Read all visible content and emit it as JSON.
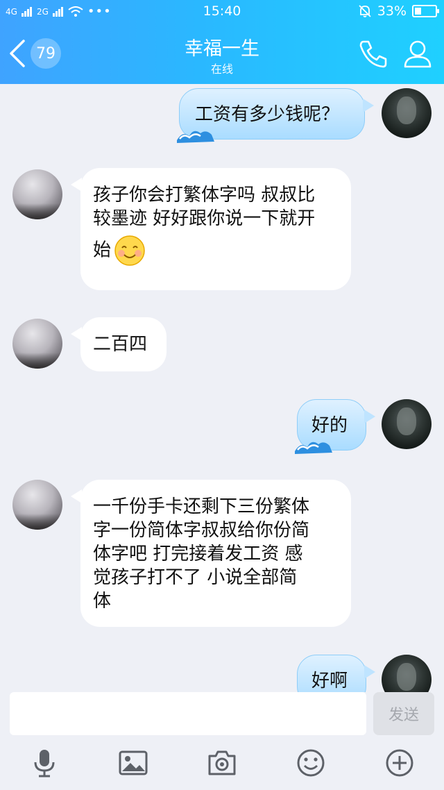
{
  "status_bar": {
    "net1": "4G",
    "net2": "2G",
    "time": "15:40",
    "battery": "33%",
    "battery_level": 0.33
  },
  "header": {
    "back_count": "79",
    "contact_name": "幸福一生",
    "contact_status": "在线"
  },
  "messages": [
    {
      "side": "right",
      "text": "工资有多少钱呢？"
    },
    {
      "side": "left",
      "lines": [
        "孩子你会打繁体字吗 叔叔比",
        "较墨迹 好好跟你说一下就开",
        "始"
      ],
      "emoji": "smile-emoji"
    },
    {
      "side": "left",
      "text": "二百四"
    },
    {
      "side": "right",
      "text": "好的"
    },
    {
      "side": "left",
      "lines": [
        "一千份手卡还剩下三份繁体",
        "字一份简体字叔叔给你份简",
        "体字吧 打完接着发工资 感",
        "觉孩子打不了  小说全部简",
        "体"
      ]
    },
    {
      "side": "right",
      "text": "好啊"
    }
  ],
  "input": {
    "value": "",
    "send_label": "发送"
  },
  "toolbar": [
    "microphone-icon",
    "image-icon",
    "camera-icon",
    "emoji-icon",
    "plus-icon"
  ],
  "colors": {
    "header_start": "#3fa3ff",
    "header_end": "#1fd0ff",
    "background": "#eef0f6"
  }
}
